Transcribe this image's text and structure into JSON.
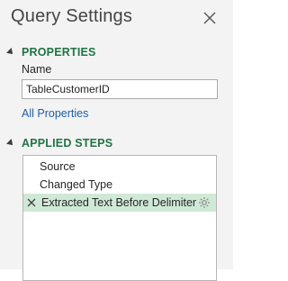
{
  "title": "Query Settings",
  "properties": {
    "header": "PROPERTIES",
    "name_label": "Name",
    "name_value": "TableCustomerID",
    "all_properties_link": "All Properties"
  },
  "applied_steps": {
    "header": "APPLIED STEPS",
    "steps": [
      {
        "label": "Source"
      },
      {
        "label": "Changed Type"
      },
      {
        "label": "Extracted Text Before Delimiter"
      }
    ],
    "selected_index": 2
  },
  "colors": {
    "section_header": "#217346",
    "link": "#1f5fa8",
    "selected_step_bg": "#cfe9d6"
  }
}
